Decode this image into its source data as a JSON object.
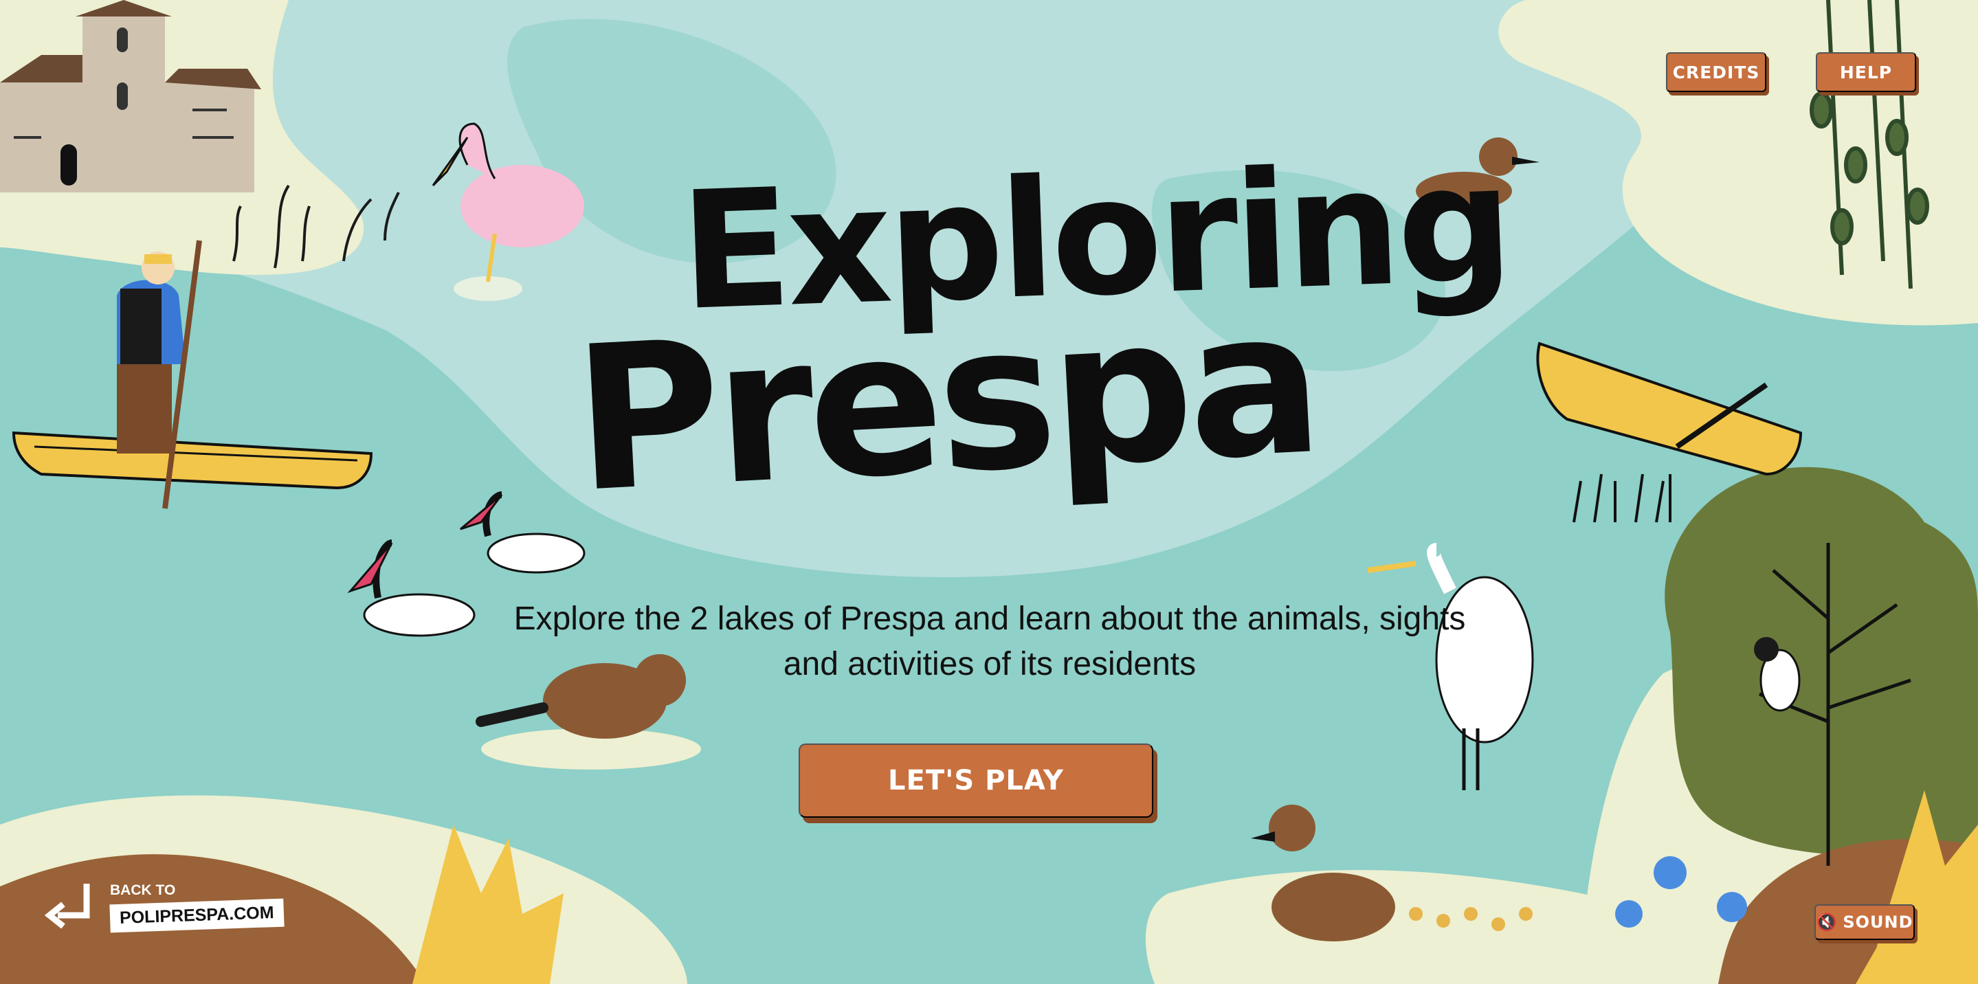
{
  "header": {
    "credits_label": "CREDITS",
    "help_label": "HELP"
  },
  "hero": {
    "title_line1": "Exploring",
    "title_line2": "Prespa",
    "subtitle_line1": "Explore the 2 lakes of Prespa and learn about the animals, sights",
    "subtitle_line2": "and activities of its residents",
    "play_label": "LET'S PLAY"
  },
  "footer": {
    "back_small": "BACK TO",
    "back_site": "POLIPRESPA.COM",
    "sound_icon": "speaker-muted-icon",
    "sound_label": "SOUND"
  },
  "colors": {
    "water": "#8fd0c8",
    "water_light": "#b8dfdc",
    "land": "#edf0d2",
    "button": "#c8703e",
    "hill": "#6a7a3a",
    "soil": "#9a6238",
    "text": "#0d0d0d"
  }
}
